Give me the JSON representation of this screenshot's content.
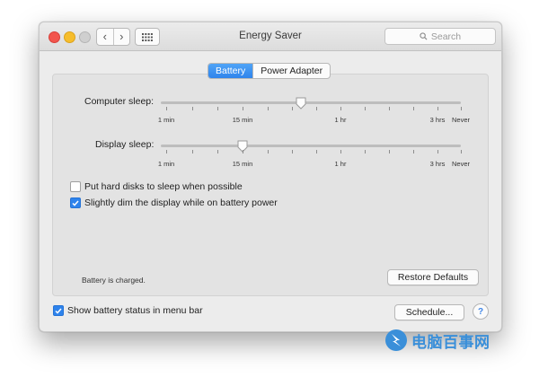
{
  "window": {
    "title": "Energy Saver",
    "search_placeholder": "Search",
    "nav_back": "‹",
    "nav_forward": "›"
  },
  "tabs": [
    {
      "label": "Battery",
      "active": true
    },
    {
      "label": "Power Adapter",
      "active": false
    }
  ],
  "sliders": {
    "tick_labels": [
      "1 min",
      "15 min",
      "1 hr",
      "3 hrs",
      "Never"
    ],
    "computer_sleep": {
      "label": "Computer sleep:",
      "value": "30 min"
    },
    "display_sleep": {
      "label": "Display sleep:",
      "value": "15 min"
    }
  },
  "options": {
    "hard_disks": {
      "label": "Put hard disks to sleep when possible",
      "checked": false
    },
    "dim_display": {
      "label": "Slightly dim the display while on battery power",
      "checked": true
    }
  },
  "status": "Battery is charged.",
  "buttons": {
    "restore_defaults": "Restore Defaults",
    "schedule": "Schedule...",
    "help": "?"
  },
  "footer": {
    "show_battery_status": {
      "label": "Show battery status in menu bar",
      "checked": true
    }
  },
  "watermark": {
    "text": "电脑百事网"
  },
  "colors": {
    "accent": "#2f84ec",
    "close": "#f2554d",
    "minimize": "#f6bd2c"
  }
}
